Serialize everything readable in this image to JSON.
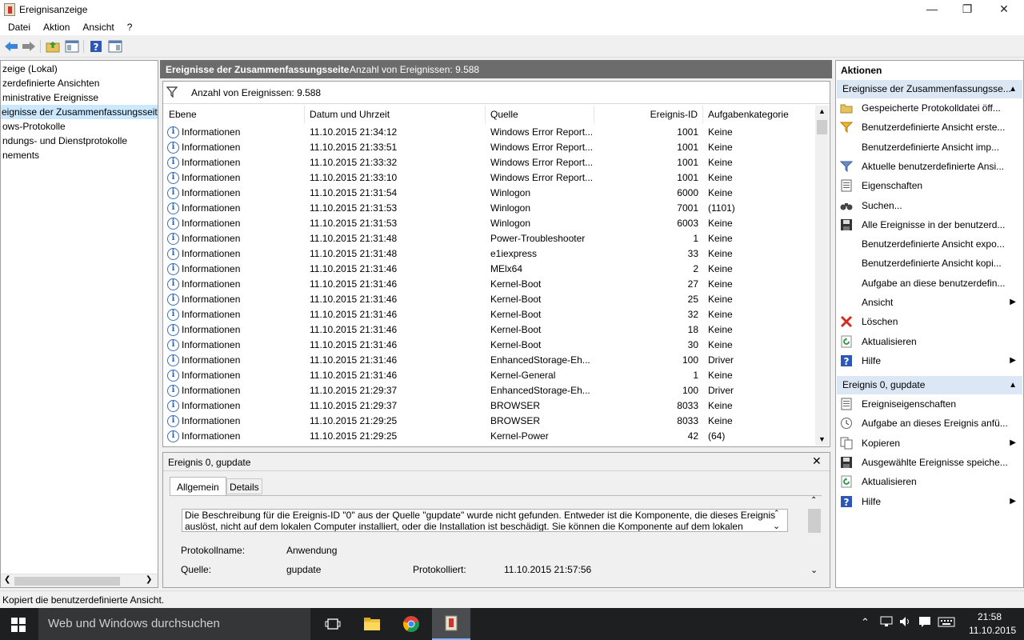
{
  "window": {
    "title": "Ereignisanzeige",
    "minimize": "—",
    "maximize": "❐",
    "close": "✕"
  },
  "menu": [
    "Datei",
    "Aktion",
    "Ansicht",
    "?"
  ],
  "nav": {
    "items": [
      {
        "label": "zeige (Lokal)",
        "selected": false
      },
      {
        "label": "zerdefinierte Ansichten",
        "selected": false
      },
      {
        "label": "ministrative Ereignisse",
        "selected": false
      },
      {
        "label": "eignisse der Zusammenfassungsseite",
        "selected": true
      },
      {
        "label": "ows-Protokolle",
        "selected": false
      },
      {
        "label": "ndungs- und Dienstprotokolle",
        "selected": false
      },
      {
        "label": "nements",
        "selected": false
      }
    ]
  },
  "center": {
    "title": "Ereignisse der Zusammenfassungsseite",
    "count": "Anzahl von Ereignissen: 9.588",
    "filter_text": "Anzahl von Ereignissen: 9.588",
    "columns": [
      "Ebene",
      "Datum und Uhrzeit",
      "Quelle",
      "Ereignis-ID",
      "Aufgabenkategorie"
    ],
    "rows": [
      [
        "Informationen",
        "11.10.2015 21:34:12",
        "Windows Error Report...",
        "1001",
        "Keine"
      ],
      [
        "Informationen",
        "11.10.2015 21:33:51",
        "Windows Error Report...",
        "1001",
        "Keine"
      ],
      [
        "Informationen",
        "11.10.2015 21:33:32",
        "Windows Error Report...",
        "1001",
        "Keine"
      ],
      [
        "Informationen",
        "11.10.2015 21:33:10",
        "Windows Error Report...",
        "1001",
        "Keine"
      ],
      [
        "Informationen",
        "11.10.2015 21:31:54",
        "Winlogon",
        "6000",
        "Keine"
      ],
      [
        "Informationen",
        "11.10.2015 21:31:53",
        "Winlogon",
        "7001",
        "(1101)"
      ],
      [
        "Informationen",
        "11.10.2015 21:31:53",
        "Winlogon",
        "6003",
        "Keine"
      ],
      [
        "Informationen",
        "11.10.2015 21:31:48",
        "Power-Troubleshooter",
        "1",
        "Keine"
      ],
      [
        "Informationen",
        "11.10.2015 21:31:48",
        "e1iexpress",
        "33",
        "Keine"
      ],
      [
        "Informationen",
        "11.10.2015 21:31:46",
        "MElx64",
        "2",
        "Keine"
      ],
      [
        "Informationen",
        "11.10.2015 21:31:46",
        "Kernel-Boot",
        "27",
        "Keine"
      ],
      [
        "Informationen",
        "11.10.2015 21:31:46",
        "Kernel-Boot",
        "25",
        "Keine"
      ],
      [
        "Informationen",
        "11.10.2015 21:31:46",
        "Kernel-Boot",
        "32",
        "Keine"
      ],
      [
        "Informationen",
        "11.10.2015 21:31:46",
        "Kernel-Boot",
        "18",
        "Keine"
      ],
      [
        "Informationen",
        "11.10.2015 21:31:46",
        "Kernel-Boot",
        "30",
        "Keine"
      ],
      [
        "Informationen",
        "11.10.2015 21:31:46",
        "EnhancedStorage-Eh...",
        "100",
        "Driver"
      ],
      [
        "Informationen",
        "11.10.2015 21:31:46",
        "Kernel-General",
        "1",
        "Keine"
      ],
      [
        "Informationen",
        "11.10.2015 21:29:37",
        "EnhancedStorage-Eh...",
        "100",
        "Driver"
      ],
      [
        "Informationen",
        "11.10.2015 21:29:37",
        "BROWSER",
        "8033",
        "Keine"
      ],
      [
        "Informationen",
        "11.10.2015 21:29:25",
        "BROWSER",
        "8033",
        "Keine"
      ],
      [
        "Informationen",
        "11.10.2015 21:29:25",
        "Kernel-Power",
        "42",
        "(64)"
      ]
    ]
  },
  "detail": {
    "title": "Ereignis 0, gupdate",
    "close": "✕",
    "tabs": [
      "Allgemein",
      "Details"
    ],
    "description_line1": "Die Beschreibung für die Ereignis-ID \"0\" aus der Quelle \"gupdate\" wurde nicht gefunden. Entweder ist die Komponente, die dieses Ereignis",
    "description_line2": "auslöst, nicht auf dem lokalen Computer installiert, oder die Installation ist beschädigt. Sie können die Komponente auf dem lokalen",
    "protokollname_label": "Protokollname:",
    "protokollname_value": "Anwendung",
    "quelle_label": "Quelle:",
    "quelle_value": "gupdate",
    "protokolliert_label": "Protokolliert:",
    "protokolliert_value": "11.10.2015 21:57:56"
  },
  "actions": {
    "header": "Aktionen",
    "section1": "Ereignisse der Zusammenfassungsse...",
    "items1": [
      {
        "label": "Gespeicherte Protokolldatei öff...",
        "icon": "open-folder-icon",
        "arrow": false
      },
      {
        "label": "Benutzerdefinierte Ansicht erste...",
        "icon": "create-filter-icon",
        "arrow": false
      },
      {
        "label": "Benutzerdefinierte Ansicht imp...",
        "icon": "",
        "arrow": false
      },
      {
        "label": "Aktuelle benutzerdefinierte Ansi...",
        "icon": "filter-icon",
        "arrow": false
      },
      {
        "label": "Eigenschaften",
        "icon": "properties-icon",
        "arrow": false
      },
      {
        "label": "Suchen...",
        "icon": "binoculars-icon",
        "arrow": false
      },
      {
        "label": "Alle Ereignisse in der benutzerd...",
        "icon": "save-icon",
        "arrow": false
      },
      {
        "label": "Benutzerdefinierte Ansicht expo...",
        "icon": "",
        "arrow": false
      },
      {
        "label": "Benutzerdefinierte Ansicht kopi...",
        "icon": "",
        "arrow": false
      },
      {
        "label": "Aufgabe an diese benutzerdefin...",
        "icon": "",
        "arrow": false
      },
      {
        "label": "Ansicht",
        "icon": "",
        "arrow": true
      },
      {
        "label": "Löschen",
        "icon": "delete-icon",
        "arrow": false
      },
      {
        "label": "Aktualisieren",
        "icon": "refresh-icon",
        "arrow": false
      },
      {
        "label": "Hilfe",
        "icon": "help-icon",
        "arrow": true
      }
    ],
    "section2": "Ereignis 0, gupdate",
    "items2": [
      {
        "label": "Ereigniseigenschaften",
        "icon": "properties-icon",
        "arrow": false
      },
      {
        "label": "Aufgabe an dieses Ereignis anfü...",
        "icon": "task-icon",
        "arrow": false
      },
      {
        "label": "Kopieren",
        "icon": "copy-icon",
        "arrow": true
      },
      {
        "label": "Ausgewählte Ereignisse speiche...",
        "icon": "save-icon",
        "arrow": false
      },
      {
        "label": "Aktualisieren",
        "icon": "refresh-icon",
        "arrow": false
      },
      {
        "label": "Hilfe",
        "icon": "help-icon",
        "arrow": true
      }
    ]
  },
  "status": {
    "text": "Kopiert die benutzerdefinierte Ansicht."
  },
  "taskbar": {
    "search_placeholder": "Web und Windows durchsuchen",
    "time": "21:58",
    "date": "11.10.2015"
  }
}
